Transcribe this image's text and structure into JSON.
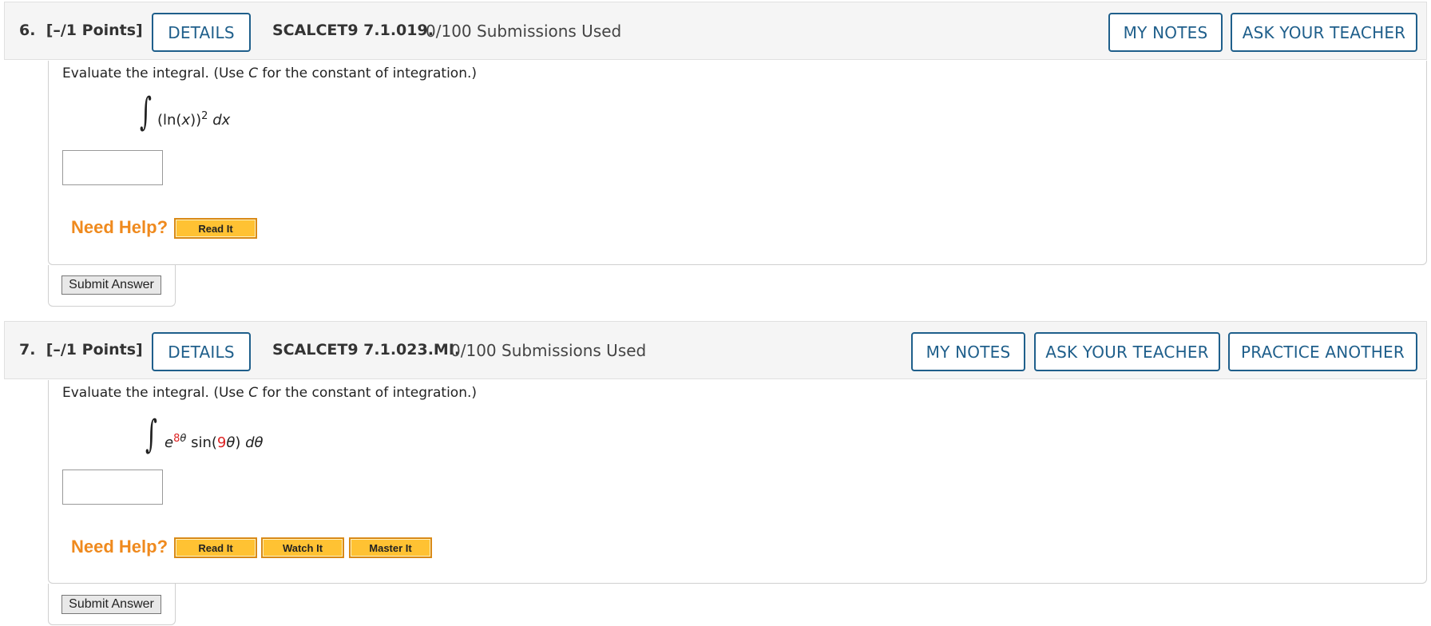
{
  "questions": [
    {
      "number": "6.",
      "points": "[–/1 Points]",
      "details_label": "DETAILS",
      "code": "SCALCET9 7.1.019.",
      "submissions": "0/100 Submissions Used",
      "my_notes_label": "MY NOTES",
      "ask_teacher_label": "ASK YOUR TEACHER",
      "prompt_before": "Evaluate the integral. (Use ",
      "prompt_var": "C",
      "prompt_after": " for the constant of integration.)",
      "integral": {
        "open": "(ln(",
        "var": "x",
        "close": "))",
        "power": "2",
        "dvar": "dx"
      },
      "answer_value": "",
      "need_help_label": "Need Help?",
      "help_buttons": [
        "Read It"
      ],
      "submit_label": "Submit Answer"
    },
    {
      "number": "7.",
      "points": "[–/1 Points]",
      "details_label": "DETAILS",
      "code": "SCALCET9 7.1.023.MI.",
      "submissions": "0/100 Submissions Used",
      "my_notes_label": "MY NOTES",
      "ask_teacher_label": "ASK YOUR TEACHER",
      "practice_label": "PRACTICE ANOTHER",
      "prompt_before": "Evaluate the integral. (Use ",
      "prompt_var": "C",
      "prompt_after": " for the constant of integration.)",
      "integral": {
        "base": "e",
        "exp_coef": "8",
        "exp_var": "θ",
        "func": "sin(",
        "arg_coef": "9",
        "arg_var": "θ",
        "func_close": ")",
        "dvar": "dθ"
      },
      "answer_value": "",
      "need_help_label": "Need Help?",
      "help_buttons": [
        "Read It",
        "Watch It",
        "Master It"
      ],
      "submit_label": "Submit Answer"
    }
  ],
  "colors": {
    "accent_blue": "#1f5f8b",
    "help_orange": "#ef8a1e",
    "help_button_fill": "#ffc233",
    "variable_red": "#dd2222"
  }
}
